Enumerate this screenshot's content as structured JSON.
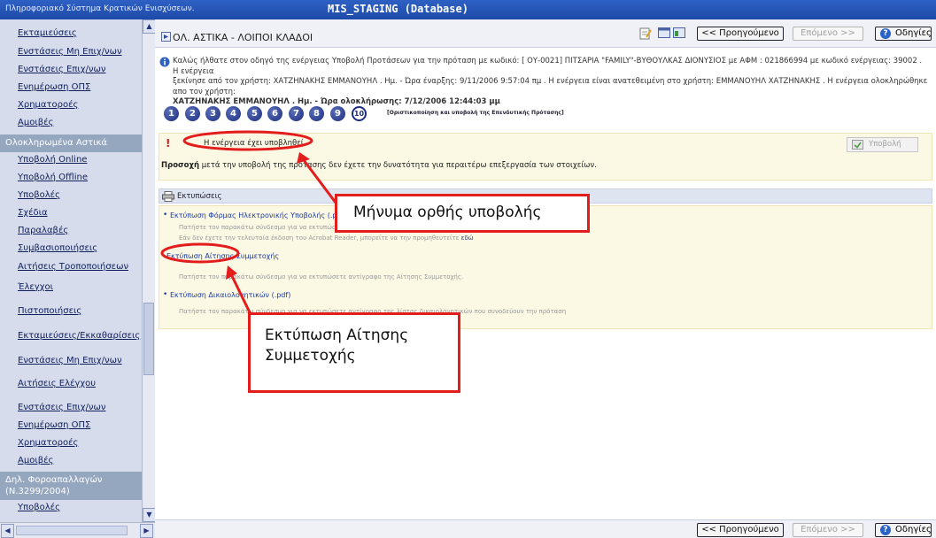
{
  "window": {
    "left_title": "Πληροφοριακό Σύστημα Κρατικών Ενισχύσεων.",
    "db_title": "MIS_STAGING (Database)"
  },
  "sidebar": {
    "items": [
      {
        "kind": "link",
        "label": "Εκταμιεύσεις"
      },
      {
        "kind": "link",
        "label": "Ενστάσεις Μη Επιχ/νων"
      },
      {
        "kind": "link",
        "label": "Ενστάσεις Επιχ/νων"
      },
      {
        "kind": "link",
        "label": "Ενημέρωση ΟΠΣ"
      },
      {
        "kind": "link",
        "label": "Χρηματοροές"
      },
      {
        "kind": "link",
        "label": "Αμοιβές"
      },
      {
        "kind": "header",
        "label": "Ολοκληρωμένα Αστικά"
      },
      {
        "kind": "link",
        "label": "Υποβολή Online"
      },
      {
        "kind": "link",
        "label": "Υποβολή Offline"
      },
      {
        "kind": "link",
        "label": "Υποβολές"
      },
      {
        "kind": "link",
        "label": "Σχέδια"
      },
      {
        "kind": "link",
        "label": "Παραλαβές"
      },
      {
        "kind": "link",
        "label": "Συμβασιοποιήσεις"
      },
      {
        "kind": "link",
        "label": "Αιτήσεις Τροποποιήσεων"
      },
      {
        "kind": "link",
        "label": "Έλεγχοι"
      },
      {
        "kind": "link",
        "label": "Πιστοποιήσεις"
      },
      {
        "kind": "link",
        "label": "Εκταμιεύσεις/Εκκαθαρίσεις"
      },
      {
        "kind": "link",
        "label": "Ενστάσεις Μη Επιχ/νων"
      },
      {
        "kind": "link",
        "label": "Αιτήσεις Ελέγχου"
      },
      {
        "kind": "link",
        "label": "Ενστάσεις Επιχ/νων"
      },
      {
        "kind": "link",
        "label": "Ενημέρωση ΟΠΣ"
      },
      {
        "kind": "link",
        "label": "Χρηματοροές"
      },
      {
        "kind": "link",
        "label": "Αμοιβές"
      },
      {
        "kind": "header",
        "label": "Δηλ. Φοροαπαλλαγών (Ν.3299/2004)"
      },
      {
        "kind": "link",
        "label": "Υποβολές"
      }
    ]
  },
  "toolbar": {
    "title": "ΟΛ. ΑΣΤΙΚΑ - ΛΟΙΠΟΙ ΚΛΑΔΟΙ",
    "prev_label": "<< Προηγούμενο",
    "next_label": "Επόμενο >>",
    "help_label": "Οδηγίες"
  },
  "info": {
    "line1": "Καλώς ήλθατε στον οδηγό της ενέργειας Υποβολή Προτάσεων για την πρόταση με κωδικό: [ ΟΥ-0021] ΠΙΤΣΑΡΙΑ \"FAMILY\"-ΒΥΘΟΥΛΚΑΣ ΔΙΟΝΥΣΙΟΣ με ΑΦΜ : 021866994 με κωδικό ενέργειας: 39002 . Η ενέργεια",
    "line2": "ξεκίνησε από τον χρήστη: ΧΑΤΖΗΝΑΚΗΣ ΕΜΜΑΝΟΥΗΛ . Ημ. - Ώρα έναρξης: 9/11/2006 9:57:04 πμ . Η ενέργεια είναι ανατεθειμένη στο χρήστη: ΕΜΜΑΝΟΥΗΛ ΧΑΤΖΗΝΑΚΗΣ . Η ενέργεια ολοκληρώθηκε απο τον χρήστη:",
    "line3": "ΧΑΤΖΗΝΑΚΗΣ ΕΜΜΑΝΟΥΗΛ . Ημ. - Ώρα ολοκλήρωσης: 7/12/2006 12:44:03 μμ"
  },
  "steps": {
    "numbers": [
      "1",
      "2",
      "3",
      "4",
      "5",
      "6",
      "7",
      "8",
      "9",
      "10"
    ],
    "active_label": "[Οριστικοποίηση και υποβολή της Επενδυτικής Πρότασης]"
  },
  "submission": {
    "message": "Η ενέργεια έχει υποβληθεί",
    "note_bold": "Προσοχή",
    "note_text": " μετά την υποβολή της πρότασης δεν έχετε την δυνατότητα για περαιτέρω επεξεργασία των στοιχείων.",
    "submit_label": "Υποβολή"
  },
  "prints": {
    "header": "Εκτυπώσεις",
    "items": [
      {
        "link": "Εκτύπωση Φόρμας Ηλεκτρονικής Υποβολής (.pdf)",
        "desc": "Πατήστε τον παρακάτω σύνδεσμο για να εκτυπώσετε αντίγραφο της Ηλεκτρονικής Υποβολής σε έγγραφο τύπου PDF.",
        "desc2": "Εάν δεν έχετε την τελευταία έκδοση του Acrobat Reader, μπορείτε να την προμηθευτείτε",
        "desc2_link": "εδώ"
      },
      {
        "link": "Εκτύπωση Αίτησης Συμμετοχής",
        "desc": "Πατήστε τον παρακάτω σύνδεσμο για να εκτυπώσετε αντίγραφο της Αίτησης Συμμετοχής."
      },
      {
        "link": "Εκτύπωση Δικαιολογητικών (.pdf)",
        "desc": "Πατήστε τον παρακάτω σύνδεσμο για να εκτυπώσετε αντίγραφο της λίστας δικαιολογητικών που συνοδεύουν την πρόταση"
      }
    ]
  },
  "annotations": {
    "callout1": "Μήνυμα ορθής υποβολής",
    "callout2": "Εκτύπωση Αίτησης Συμμετοχής",
    "color": "#e31c1c"
  },
  "theme": {
    "titlebar": "#1d4aa8",
    "sidebar_bg": "#d6dcec",
    "sidebar_header": "#95a6bf",
    "panel_yellow": "#fbf8e4",
    "link": "#1a3aa0"
  }
}
